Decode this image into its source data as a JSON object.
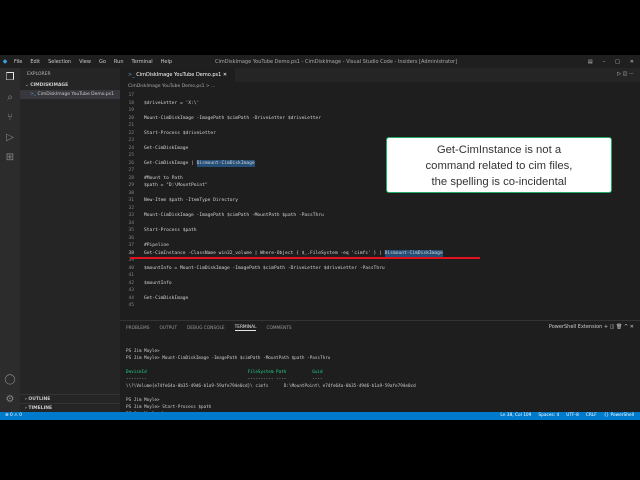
{
  "titlebar": {
    "menu": [
      "File",
      "Edit",
      "Selection",
      "View",
      "Go",
      "Run",
      "Terminal",
      "Help"
    ],
    "title": "CimDiskImage YouTube Demo.ps1 - CimDiskImage - Visual Studio Code - Insiders [Administrator]"
  },
  "sidebar": {
    "header": "EXPLORER",
    "folder": "CIMDISKIMAGE",
    "file": "CimDiskImage YouTube Demo.ps1",
    "outline": "OUTLINE",
    "timeline": "TIMELINE"
  },
  "editor": {
    "tab": "CimDiskImage YouTube Demo.ps1",
    "breadcrumb": "CimDiskImage YouTube Demo.ps1 > ...",
    "lines": [
      {
        "n": "17",
        "t": ""
      },
      {
        "n": "18",
        "t": "$driveLetter = 'X:\\'"
      },
      {
        "n": "19",
        "t": ""
      },
      {
        "n": "20",
        "t": "Mount-CimDiskImage -ImagePath $cimPath -DriveLetter $driveLetter"
      },
      {
        "n": "21",
        "t": ""
      },
      {
        "n": "22",
        "t": "Start-Process $driveLetter"
      },
      {
        "n": "23",
        "t": ""
      },
      {
        "n": "24",
        "t": "Get-CimDiskImage"
      },
      {
        "n": "25",
        "t": ""
      },
      {
        "n": "26",
        "t": "Get-CimDiskImage | ",
        "h": "Dismount-CimDiskImage"
      },
      {
        "n": "27",
        "t": ""
      },
      {
        "n": "28",
        "t": "#Mount to Path",
        "c": true
      },
      {
        "n": "29",
        "t": "$path = \"D:\\MountPoint\""
      },
      {
        "n": "30",
        "t": ""
      },
      {
        "n": "31",
        "t": "New-Item $path -ItemType Directory"
      },
      {
        "n": "32",
        "t": ""
      },
      {
        "n": "33",
        "t": "Mount-CimDiskImage -ImagePath $cimPath -MountPath $path -PassThru"
      },
      {
        "n": "34",
        "t": ""
      },
      {
        "n": "35",
        "t": "Start-Process $path"
      },
      {
        "n": "36",
        "t": ""
      },
      {
        "n": "37",
        "t": "#Pipeline",
        "c": true
      },
      {
        "n": "38",
        "t": "Get-CimInstance -ClassName win32_volume | Where-Object { $_.FileSystem -eq 'cimfs' } | ",
        "h": "Dismount-CimDiskImage",
        "cur": true
      },
      {
        "n": "39",
        "t": "",
        "u": true
      },
      {
        "n": "40",
        "t": "$mountInfo = Mount-CimDiskImage -ImagePath $cimPath -DriveLetter $driveLetter -PassThru"
      },
      {
        "n": "41",
        "t": ""
      },
      {
        "n": "42",
        "t": "$mountInfo"
      },
      {
        "n": "43",
        "t": ""
      },
      {
        "n": "44",
        "t": "Get-CimDiskImage"
      },
      {
        "n": "45",
        "t": ""
      }
    ]
  },
  "panel": {
    "tabs": [
      "PROBLEMS",
      "OUTPUT",
      "DEBUG CONSOLE",
      "TERMINAL",
      "COMMENTS"
    ],
    "active": "TERMINAL",
    "shell_label": "PowerShell Extension",
    "terminal": [
      "",
      "PS Jim Moyle>",
      "PS Jim Moyle> Mount-CimDiskImage -ImagePath $cimPath -MountPath $path -PassThru",
      "",
      "DeviceId                                       FileSystem Path          Guid",
      "--------                                       ---------- ----          ----",
      "\\\\?\\Volume{e74fe64a-0b35-49d6-b1a9-59afe794e0cd}\\ cimfs      D:\\MountPoint\\ e74fe64a-0b35-49d6-b1a9-59afe794e0cd",
      "",
      "PS Jim Moyle>",
      "PS Jim Moyle> Start-Process $path",
      "PS Jim Moyle> ▏"
    ]
  },
  "status": {
    "left": "⊗ 0 ⚠ 0",
    "items": [
      "Ln 38, Col 109",
      "Spaces: 4",
      "UTF-8",
      "CRLF",
      "{} PowerShell"
    ]
  },
  "callout": {
    "lines": [
      "Get-CimInstance  is not a",
      "command related to cim files,",
      "the spelling is co-incidental"
    ]
  },
  "colors": {
    "accent": "#007acc",
    "underline": "#e0121d"
  }
}
